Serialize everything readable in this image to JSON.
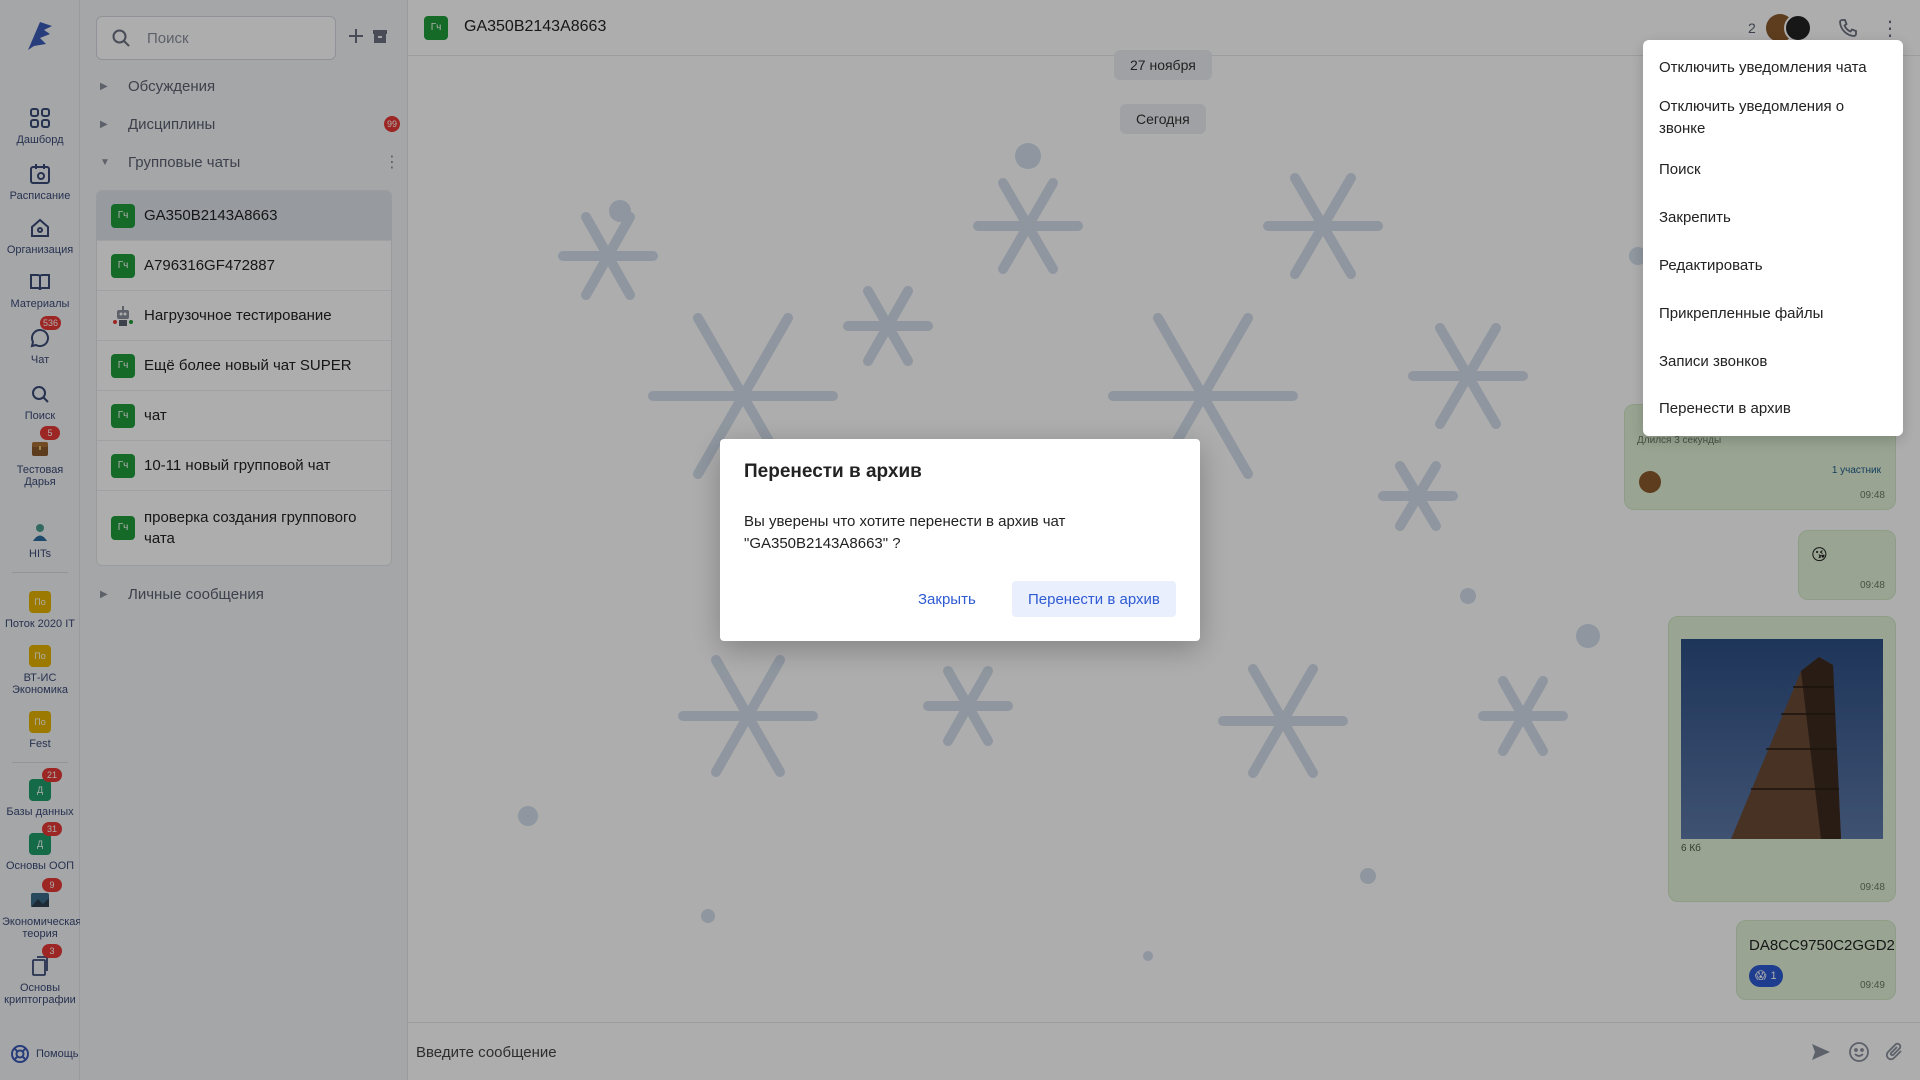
{
  "rail": {
    "items": [
      {
        "label": "Дашборд"
      },
      {
        "label": "Расписание"
      },
      {
        "label": "Организация"
      },
      {
        "label": "Материалы"
      },
      {
        "label": "Чат",
        "badge": "536"
      },
      {
        "label": "Поиск"
      },
      {
        "label": "Тестовая Дарья",
        "badge": "5"
      },
      {
        "label": "HITs"
      },
      {
        "label": "Поток 2020 IT",
        "abbr": "По"
      },
      {
        "label": "ВТ-ИС Экономика",
        "abbr": "По"
      },
      {
        "label": "Fest",
        "abbr": "По"
      },
      {
        "label": "Базы данных",
        "abbr": "Д",
        "badge": "21"
      },
      {
        "label": "Основы ООП",
        "abbr": "Д",
        "badge": "31"
      },
      {
        "label": "Экономическая теория",
        "badge": "9"
      },
      {
        "label": "Основы криптографии",
        "badge": "3"
      }
    ],
    "help_label": "Помощь"
  },
  "panel": {
    "search_placeholder": "Поиск",
    "sections": [
      {
        "label": "Обсуждения"
      },
      {
        "label": "Дисциплины",
        "badge": "99"
      },
      {
        "label": "Групповые чаты"
      },
      {
        "label": "Личные сообщения"
      }
    ],
    "group_chats": [
      {
        "abbr": "Гч",
        "name": "GA350B2143A8663"
      },
      {
        "abbr": "Гч",
        "name": "A796316GF472887"
      },
      {
        "abbr": "",
        "name": "Нагрузочное тестирование"
      },
      {
        "abbr": "Гч",
        "name": "Ещё более новый чат SUPER"
      },
      {
        "abbr": "Гч",
        "name": "чат"
      },
      {
        "abbr": "Гч",
        "name": "10-11 новый групповой чат"
      },
      {
        "abbr": "Гч",
        "name": "проверка создания группового чата"
      }
    ]
  },
  "chat": {
    "abbr": "Гч",
    "title": "GA350B2143A8663",
    "participants_count": "2",
    "dates": [
      "27 ноября",
      "Сегодня"
    ],
    "messages": [
      {
        "sub": "Длился 3 секунды",
        "participants": "1 участник",
        "time": "09:48"
      },
      {
        "emoji": "😘",
        "time": "09:48"
      },
      {
        "file_size": "6 Кб",
        "time": "09:48"
      },
      {
        "text": "DA8CC9750C2GGD2",
        "reaction_count": "1",
        "time": "09:49"
      }
    ],
    "composer_placeholder": "Введите сообщение"
  },
  "menu": {
    "items": [
      "Отключить уведомления чата",
      "Отключить уведомления о звонке",
      "Поиск",
      "Закрепить",
      "Редактировать",
      "Прикрепленные файлы",
      "Записи звонков",
      "Перенести в архив"
    ]
  },
  "dialog": {
    "title": "Перенести в архив",
    "text": "Вы уверены что хотите перенести в архив чат \"GA350B2143A8663\" ?",
    "cancel_label": "Закрыть",
    "confirm_label": "Перенести в архив"
  },
  "colors": {
    "accent": "#2f5bd3",
    "group_chat": "#1f9d3a",
    "badge": "#e53935",
    "bubble": "#e2f3d7",
    "stream": "#e6b400",
    "database": "#1f9d6a"
  }
}
